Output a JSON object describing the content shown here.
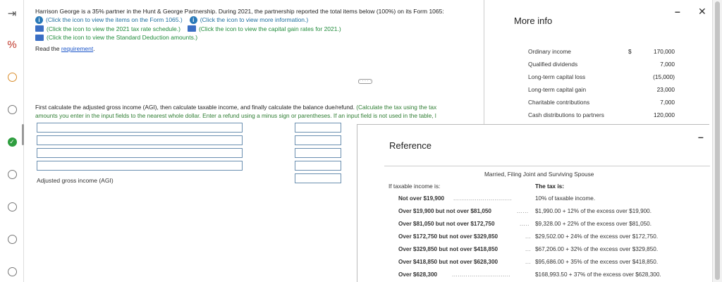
{
  "problem": {
    "intro": "Harrison George is a 35% partner in the Hunt & George Partnership. During 2021, the partnership reported the total items below (100%) on its Form 1065:",
    "link_items": "(Click the icon to view the items on the Form 1065.)",
    "link_more_info": "(Click the icon to view more information.)",
    "link_tax_schedule": "(Click the icon to view the 2021 tax rate schedule.)",
    "link_capital_gain": "(Click the icon to view the capital gain rates for 2021.)",
    "link_std_deduction": "(Click the icon to view the Standard Deduction amounts.)",
    "read_prefix": "Read the ",
    "read_link": "requirement",
    "read_suffix": ".",
    "expand_label": "· · · · ·",
    "instruction_main": "First calculate the adjusted gross income (AGI), then calculate taxable income, and finally calculate the balance due/refund.",
    "instruction_note": "(Calculate the tax using the tax",
    "instruction_line2": "amounts you enter in the input fields to the nearest whole dollar. Enter a refund using a minus sign or parentheses. If an input field is not used in the table, l",
    "agi_label": "Adjusted gross income (AGI)"
  },
  "more_info": {
    "title": "More info",
    "rows": [
      {
        "label": "Ordinary income",
        "currency": "$",
        "value": "170,000"
      },
      {
        "label": "Qualified dividends",
        "currency": "",
        "value": "7,000"
      },
      {
        "label": "Long-term capital loss",
        "currency": "",
        "value": "(15,000)"
      },
      {
        "label": "Long-term capital gain",
        "currency": "",
        "value": "23,000"
      },
      {
        "label": "Charitable contributions",
        "currency": "",
        "value": "7,000"
      },
      {
        "label": "Cash distributions to partners",
        "currency": "",
        "value": "120,000"
      }
    ],
    "minimize": "–",
    "close": "✕"
  },
  "reference": {
    "title": "Reference",
    "heading": "Married, Filing Joint and Surviving Spouse",
    "left_sub": "If taxable income is:",
    "right_sub": "The tax is:",
    "minimize": "–",
    "brackets": [
      {
        "cond": "Not over $19,900",
        "tax": "10% of taxable income."
      },
      {
        "cond": "Over $19,900 but not over $81,050",
        "tax": "$1,990.00 + 12% of the excess over $19,900."
      },
      {
        "cond": "Over $81,050 but not over $172,750",
        "tax": "$9,328.00 + 22% of the excess over $81,050."
      },
      {
        "cond": "Over $172,750 but not over $329,850",
        "tax": "$29,502.00 + 24% of the excess over $172,750."
      },
      {
        "cond": "Over $329,850 but not over $418,850",
        "tax": "$67,206.00 + 32% of the excess over $329,850."
      },
      {
        "cond": "Over $418,850 but not over $628,300",
        "tax": "$95,686.00 + 35% of the excess over $418,850."
      },
      {
        "cond": "Over $628,300",
        "tax": "$168,993.50 + 37% of the excess over $628,300."
      }
    ]
  },
  "rail": {
    "icons": [
      "arrow-right-bar-icon",
      "percent-icon",
      "circle-icon",
      "circle-icon",
      "check-circle-icon",
      "circle-icon",
      "circle-icon",
      "circle-icon",
      "circle-icon"
    ],
    "accent": "#2e9e3f"
  }
}
